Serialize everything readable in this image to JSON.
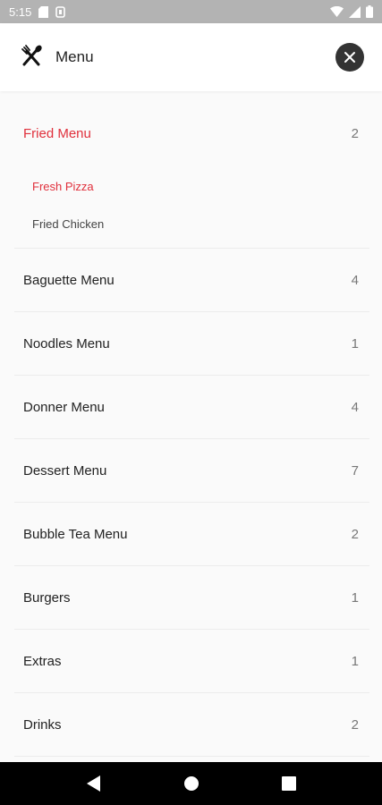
{
  "status_bar": {
    "time": "5:15"
  },
  "header": {
    "title": "Menu",
    "icon": "fork-spoon-icon",
    "close_icon": "close-icon"
  },
  "expanded_category": {
    "label": "Fried Menu",
    "count": "2",
    "items": [
      {
        "label": "Fresh Pizza",
        "active": true
      },
      {
        "label": "Fried Chicken",
        "active": false
      }
    ]
  },
  "categories": [
    {
      "label": "Baguette Menu",
      "count": "4"
    },
    {
      "label": "Noodles Menu",
      "count": "1"
    },
    {
      "label": "Donner Menu",
      "count": "4"
    },
    {
      "label": "Dessert Menu",
      "count": "7"
    },
    {
      "label": "Bubble Tea Menu",
      "count": "2"
    },
    {
      "label": "Burgers",
      "count": "1"
    },
    {
      "label": "Extras",
      "count": "1"
    },
    {
      "label": "Drinks",
      "count": "2"
    }
  ],
  "colors": {
    "accent": "#e0303c",
    "status_bar": "#b3b3b3",
    "close_button": "#333333"
  }
}
